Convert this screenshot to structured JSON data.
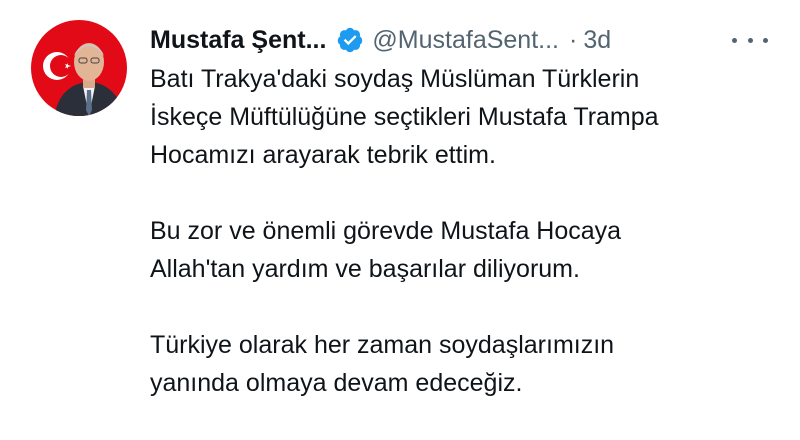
{
  "tweet": {
    "author": {
      "display_name": "Mustafa Şent...",
      "handle": "@MustafaSent...",
      "verified": true,
      "avatar_icon": "profile-photo"
    },
    "separator": "·",
    "time": "3d",
    "more_icon": "more-horizontal-icon",
    "paragraphs": [
      {
        "lines": [
          "Batı Trakya'daki soydaş Müslüman Türklerin",
          "İskeçe Müftülüğüne seçtikleri Mustafa Trampa",
          "Hocamızı arayarak tebrik ettim."
        ]
      },
      {
        "lines": [
          "Bu zor ve önemli görevde Mustafa Hocaya",
          "Allah'tan yardım ve başarılar diliyorum."
        ]
      },
      {
        "lines": [
          "Türkiye olarak her zaman soydaşlarımızın",
          "yanında olmaya devam edeceğiz."
        ]
      }
    ]
  },
  "colors": {
    "text": "#0f1419",
    "secondary": "#536471",
    "verified_badge": "#1d9bf0",
    "flag_red": "#e30a17"
  }
}
